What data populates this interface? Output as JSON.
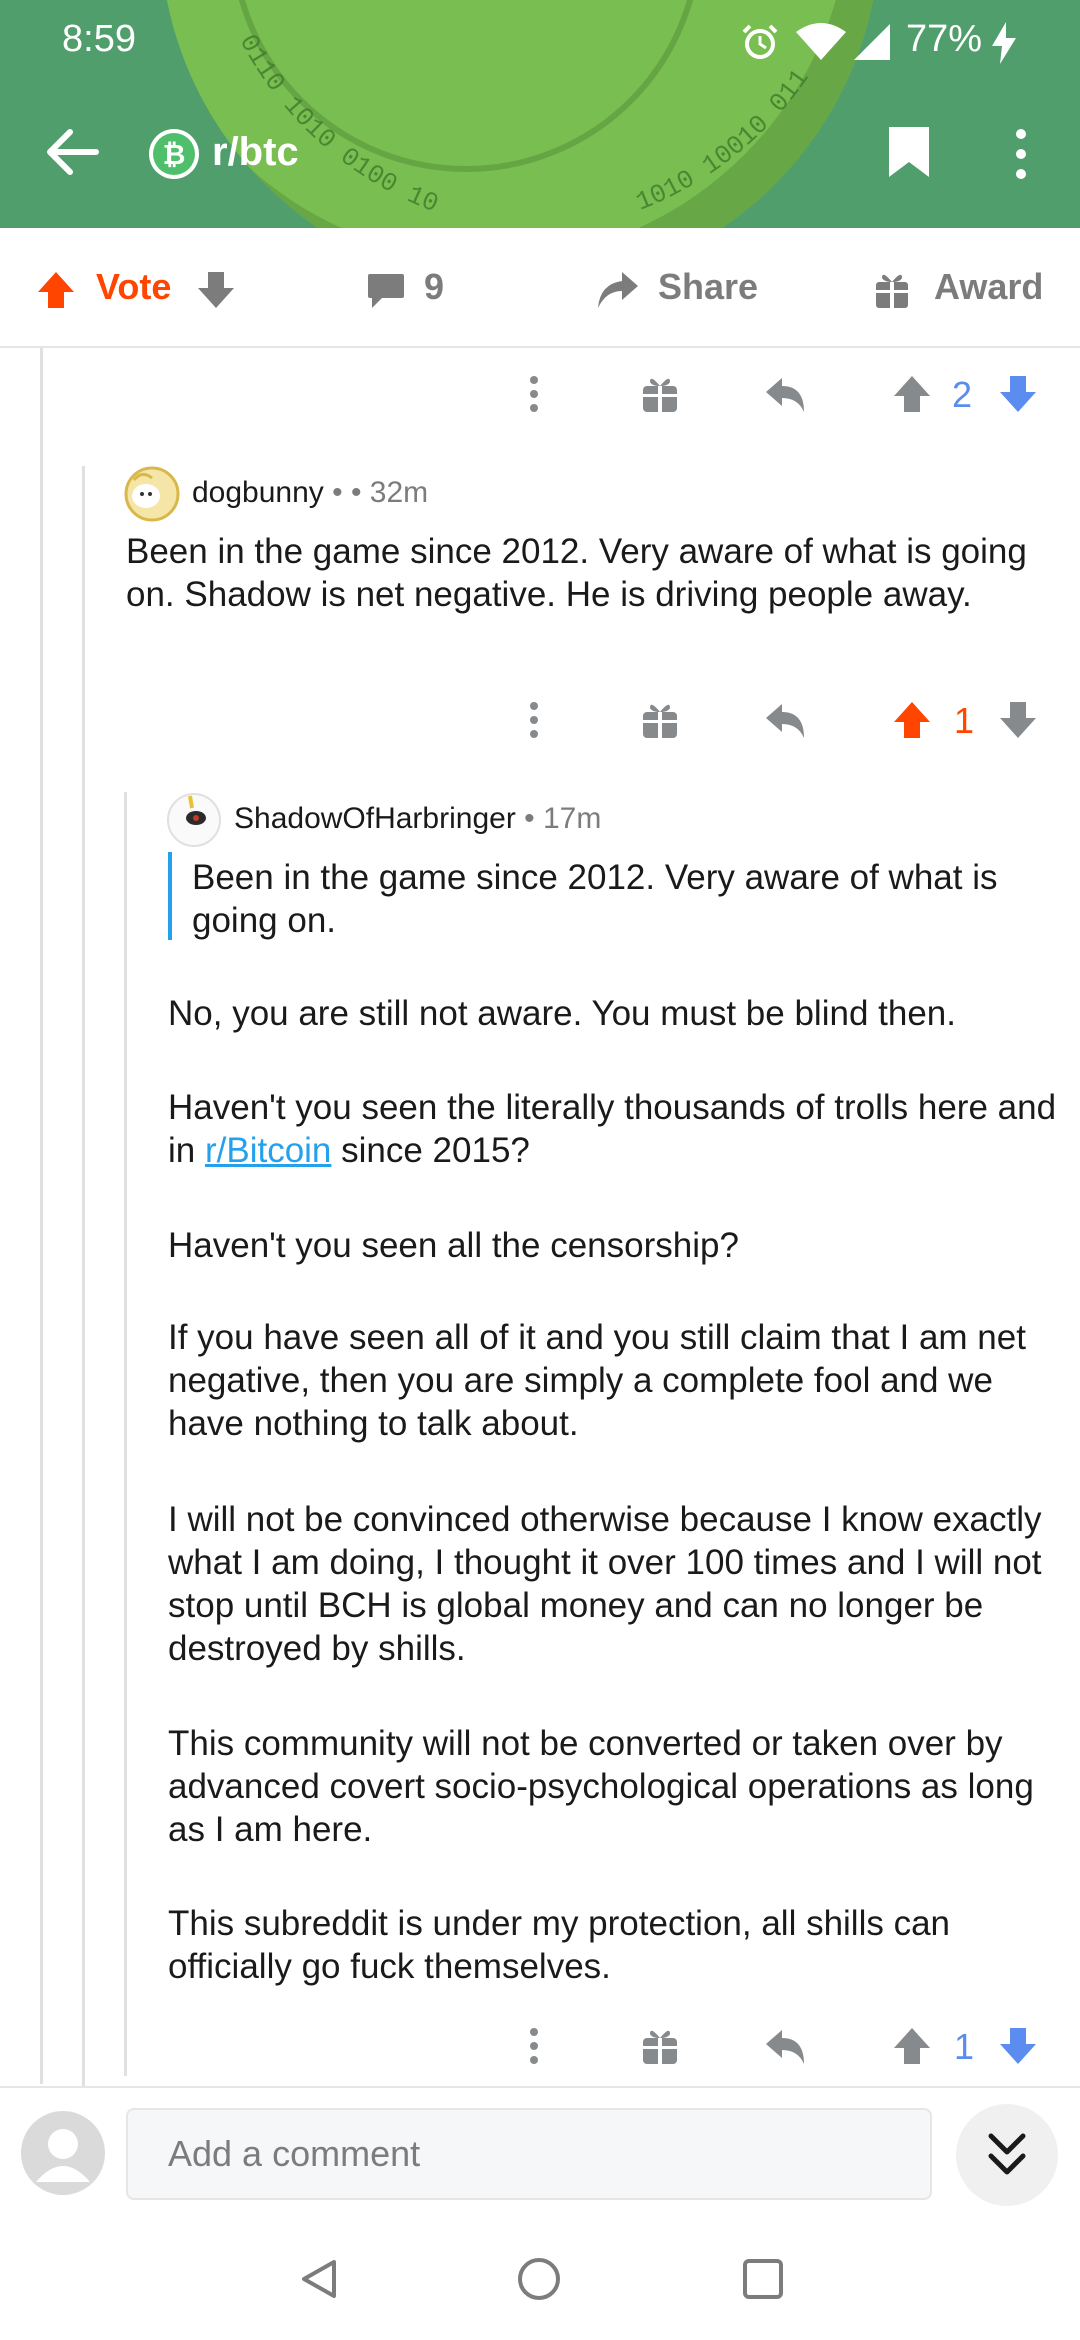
{
  "status_bar": {
    "time": "8:59",
    "battery": "77%"
  },
  "header": {
    "subreddit": "r/btc",
    "coin_text_1": "0110 1010 0100 10",
    "coin_text_2": "1010 10010 011"
  },
  "action_bar": {
    "vote_label": "Vote",
    "comment_count": "9",
    "share_label": "Share",
    "award_label": "Award"
  },
  "comments": [
    {
      "score": "2",
      "vote_state": "none"
    },
    {
      "author": "dogbunny",
      "meta": " •  • 32m",
      "body": "Been in the game since 2012. Very aware of what is going on. Shadow is net negative. He is driving people away.",
      "score": "1",
      "vote_state": "upvoted"
    },
    {
      "author": "ShadowOfHarbringer",
      "meta": " • 17m",
      "quote": "Been in the game since 2012. Very aware of what is going on.",
      "paragraphs": [
        "No, you are still not aware. You must be blind then.",
        {
          "before": "Haven't you seen the literally thousands of trolls here and in ",
          "link": "r/Bitcoin",
          "after": " since 2015?"
        },
        "Haven't you seen all the censorship?",
        "If you have seen all of it and you still claim that I am net negative, then you are simply a complete fool and we have nothing to talk about.",
        "I will not be convinced otherwise because I know exactly what I am doing, I thought it over 100 times and I will not stop until BCH is global money and can no longer be destroyed by shills.",
        "This community will not be converted or taken over by advanced covert socio-psychological operations as long as I am here.",
        "This subreddit is under my protection, all shills can officially go fuck themselves."
      ],
      "score": "1",
      "vote_state": "none"
    }
  ],
  "comment_bar": {
    "placeholder": "Add a comment"
  },
  "colors": {
    "header_green": "#4f9e6c",
    "upvote_orange": "#ff4500",
    "downvote_blue": "#5b8cf0",
    "link_blue": "#24a0ed"
  },
  "icons": [
    "back-arrow-icon",
    "bitcoin-icon",
    "bookmark-icon",
    "overflow-menu-icon",
    "upvote-icon",
    "downvote-icon",
    "comment-icon",
    "share-icon",
    "gift-icon",
    "reply-icon",
    "collapse-icon",
    "avatar-icon"
  ]
}
